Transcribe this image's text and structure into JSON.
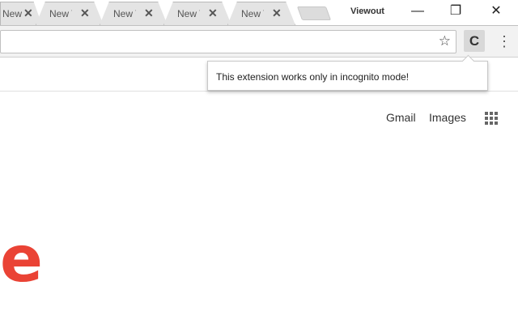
{
  "tabs": [
    {
      "label": "New Tab"
    },
    {
      "label": "New Tab"
    },
    {
      "label": "New Tab"
    },
    {
      "label": "New Tab"
    },
    {
      "label": "New Tab"
    }
  ],
  "profile_name": "Viewout",
  "window_controls": {
    "minimize": "—",
    "restore": "❐",
    "close": "✕"
  },
  "tooltip": {
    "text": "This extension works only in incognito mode!"
  },
  "page": {
    "gmail": "Gmail",
    "images": "Images",
    "logo_letter": "e"
  },
  "colors": {
    "logo": "#ea4335"
  }
}
